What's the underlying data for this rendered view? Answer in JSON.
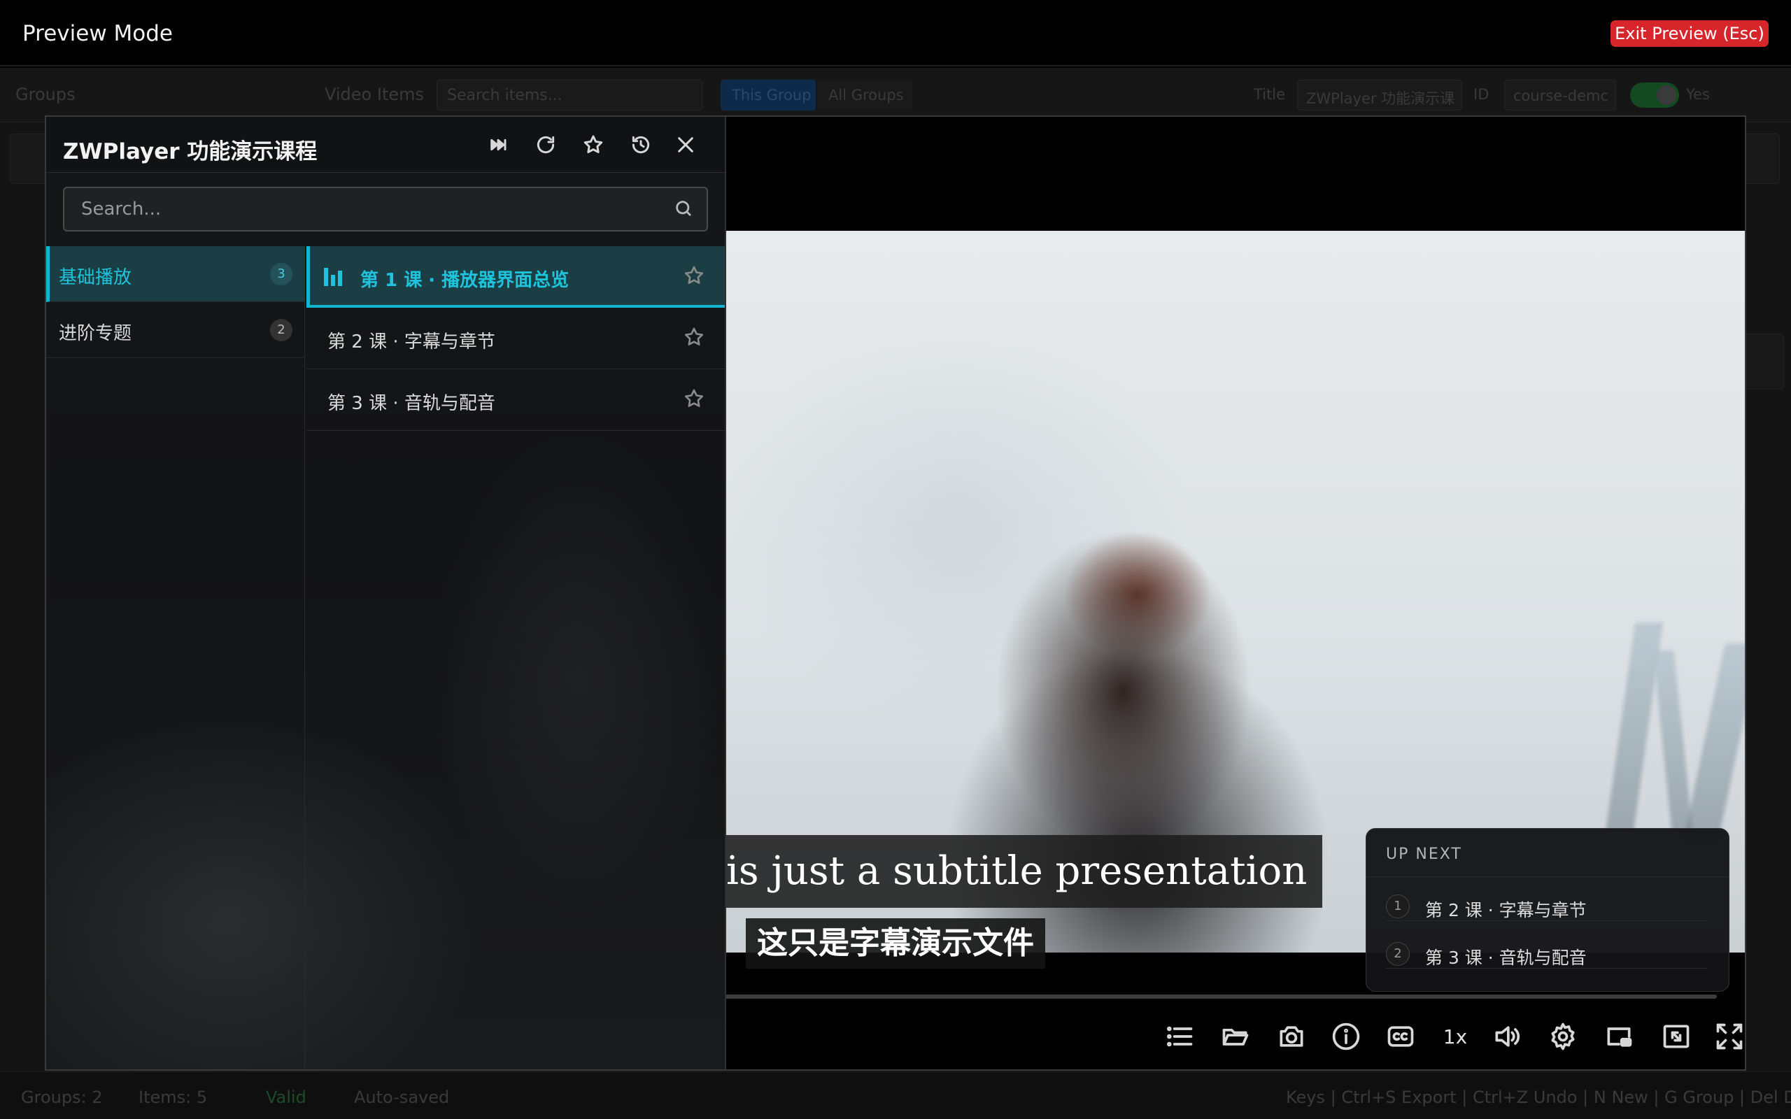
{
  "topbar": {
    "title": "Preview Mode",
    "exit_label": "Exit Preview (Esc)"
  },
  "background_app": {
    "groups_label": "Groups",
    "video_items_label": "Video Items",
    "search_placeholder": "Search items...",
    "scope_this": "This Group",
    "scope_all": "All Groups",
    "title_label": "Title",
    "title_value": "ZWPlayer 功能演示课",
    "id_label": "ID",
    "id_value": "course-demc",
    "toggle_label": "Yes",
    "status": {
      "groups": "Groups: 2",
      "items": "Items: 5",
      "valid": "Valid",
      "autosaved": "Auto-saved",
      "shortcuts": "Keys | Ctrl+S Export | Ctrl+Z Undo | N New | G Group | Del Delete"
    }
  },
  "playlist": {
    "title": "ZWPlayer 功能演示课程",
    "search_placeholder": "Search...",
    "groups": [
      {
        "label": "基础播放",
        "count": "3",
        "active": true
      },
      {
        "label": "进阶专题",
        "count": "2",
        "active": false
      }
    ],
    "items": [
      {
        "label": "第 1 课 · 播放器界面总览",
        "active": true
      },
      {
        "label": "第 2 课 · 字幕与章节",
        "active": false
      },
      {
        "label": "第 3 课 · 音轨与配音",
        "active": false
      }
    ]
  },
  "subtitles": {
    "english": "is just a subtitle presentation",
    "chinese": "这只是字幕演示文件"
  },
  "up_next": {
    "header": "UP NEXT",
    "items": [
      {
        "num": "1",
        "label": "第 2 课 · 字幕与章节"
      },
      {
        "num": "2",
        "label": "第 3 课 · 音轨与配音"
      }
    ]
  },
  "controls": {
    "speed": "1x"
  },
  "colors": {
    "accent": "#13b6cf",
    "exit_button": "#d7262b"
  }
}
